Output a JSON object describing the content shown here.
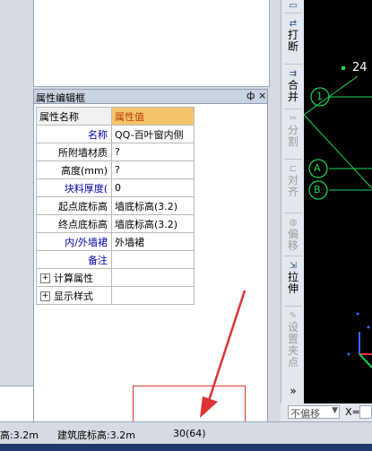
{
  "panel": {
    "title": "属性编辑框",
    "pin": "ф",
    "close": "×",
    "header": {
      "name": "属性名称",
      "value": "属性值"
    },
    "rows": [
      {
        "name": "名称",
        "value": "QQ-百叶窗内侧",
        "blue": true
      },
      {
        "name": "所附墙材质",
        "value": "?",
        "blue": false
      },
      {
        "name": "高度(mm)",
        "value": "?",
        "blue": false
      },
      {
        "name": "块料厚度(",
        "value": "0",
        "blue": true
      },
      {
        "name": "起点底标高",
        "value": "墙底标高(3.2)",
        "blue": false
      },
      {
        "name": "终点底标高",
        "value": "墙底标高(3.2)",
        "blue": false
      },
      {
        "name": "内/外墙裙",
        "value": "外墙裙",
        "blue": true
      },
      {
        "name": "备注",
        "value": "",
        "blue": true
      }
    ],
    "groups": [
      "计算属性",
      "显示样式"
    ]
  },
  "toolbar": {
    "items": [
      {
        "label": "打断",
        "icon": "break-icon",
        "enabled": true
      },
      {
        "label": "合并",
        "icon": "merge-icon",
        "enabled": true
      },
      {
        "label": "分割",
        "icon": "split-icon",
        "enabled": false
      },
      {
        "label": "对齐",
        "icon": "align-icon",
        "enabled": false
      },
      {
        "label": "偏移",
        "icon": "offset-icon",
        "enabled": false
      },
      {
        "label": "拉伸",
        "icon": "stretch-icon",
        "enabled": true
      },
      {
        "label": "设置夹点",
        "icon": "grip-icon",
        "enabled": false
      }
    ]
  },
  "cad": {
    "number": "24",
    "axis_labels": [
      "1",
      "A",
      "B"
    ]
  },
  "bottom": {
    "offset_select": "不偏移",
    "x_label": "X="
  },
  "status": {
    "floor_height": "高:3.2m",
    "building_elev": "建筑底标高:3.2m",
    "count": "30(64)"
  },
  "colors": {
    "accent_header": "#f6c46b",
    "annotation": "#dd3333",
    "cad_green": "#19d95a"
  }
}
